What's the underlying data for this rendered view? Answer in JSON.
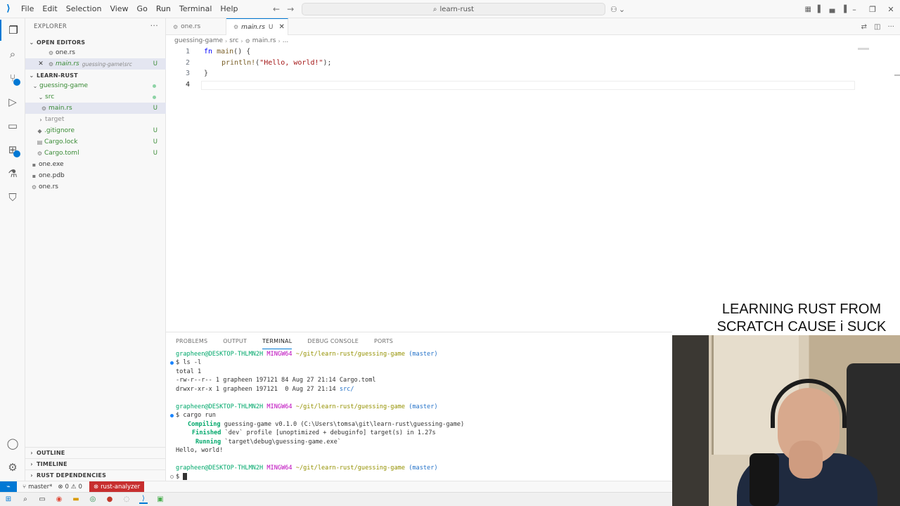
{
  "menu": [
    "File",
    "Edit",
    "Selection",
    "View",
    "Go",
    "Run",
    "Terminal",
    "Help"
  ],
  "command_center": {
    "label": "learn-rust"
  },
  "sidebar": {
    "header": "EXPLORER",
    "open_editors": {
      "title": "OPEN EDITORS",
      "items": [
        {
          "name": "one.rs",
          "desc": "",
          "status": ""
        },
        {
          "name": "main.rs",
          "desc": "guessing-game\\src",
          "status": "U"
        }
      ]
    },
    "workspace": {
      "title": "LEARN-RUST",
      "folder": "guessing-game",
      "src": "src",
      "main": "main.rs",
      "target": "target",
      "gitignore": ".gitignore",
      "cargo_lock": "Cargo.lock",
      "cargo_toml": "Cargo.toml",
      "one_exe": "one.exe",
      "one_pdb": "one.pdb",
      "one_rs": "one.rs",
      "untracked": "U"
    },
    "outline": "OUTLINE",
    "timeline": "TIMELINE",
    "rust_deps": "RUST DEPENDENCIES"
  },
  "tabs": [
    {
      "label": "one.rs"
    },
    {
      "label": "main.rs",
      "modified": "U"
    }
  ],
  "breadcrumb": [
    "guessing-game",
    "src",
    "main.rs",
    "..."
  ],
  "editor": {
    "line_numbers": [
      "1",
      "2",
      "3",
      "4"
    ],
    "code": {
      "l1_kw": "fn",
      "l1_name": "main",
      "l1_rest": "() {",
      "l2_macro": "println!",
      "l2_open": "(",
      "l2_str": "\"Hello, world!\"",
      "l2_close": ");",
      "l3": "}"
    }
  },
  "panel": {
    "tabs": [
      "PROBLEMS",
      "OUTPUT",
      "TERMINAL",
      "DEBUG CONSOLE",
      "PORTS"
    ],
    "active_tab": "TERMINAL",
    "prompt": {
      "user": "grapheen@DESKTOP-THLMN2H",
      "host": "MINGW64",
      "path": "~/git/learn-rust/guessing-game",
      "branch": "(master)"
    },
    "cmd1": "$ ls -l",
    "out1": "total 1",
    "out2": "-rw-r--r-- 1 grapheen 197121 84 Aug 27 21:14 Cargo.toml",
    "out3_pre": "drwxr-xr-x 1 grapheen 197121  0 Aug 27 21:14 ",
    "out3_dir": "src/",
    "cmd2": "$ cargo run",
    "compiling_label": "Compiling",
    "compiling_rest": " guessing-game v0.1.0 (C:\\Users\\tomsa\\git\\learn-rust\\guessing-game)",
    "finished_label": "Finished",
    "finished_rest": " `dev` profile [unoptimized + debuginfo] target(s) in 1.27s",
    "running_label": "Running",
    "running_rest": " `target\\debug\\guessing-game.exe`",
    "hello": "Hello, world!",
    "final_prompt": "$ "
  },
  "overlay": {
    "line1": "LEARNING RUST FROM",
    "line2": "SCRATCH CAUSE i SUCK"
  },
  "statusbar": {
    "branch": "master*",
    "errors": "0",
    "warnings": "0",
    "rust_analyzer": "rust-analyzer"
  },
  "colors": {
    "accent": "#0078d4",
    "rust_analyzer_bg": "#c72e2e",
    "untracked": "#388a34"
  }
}
